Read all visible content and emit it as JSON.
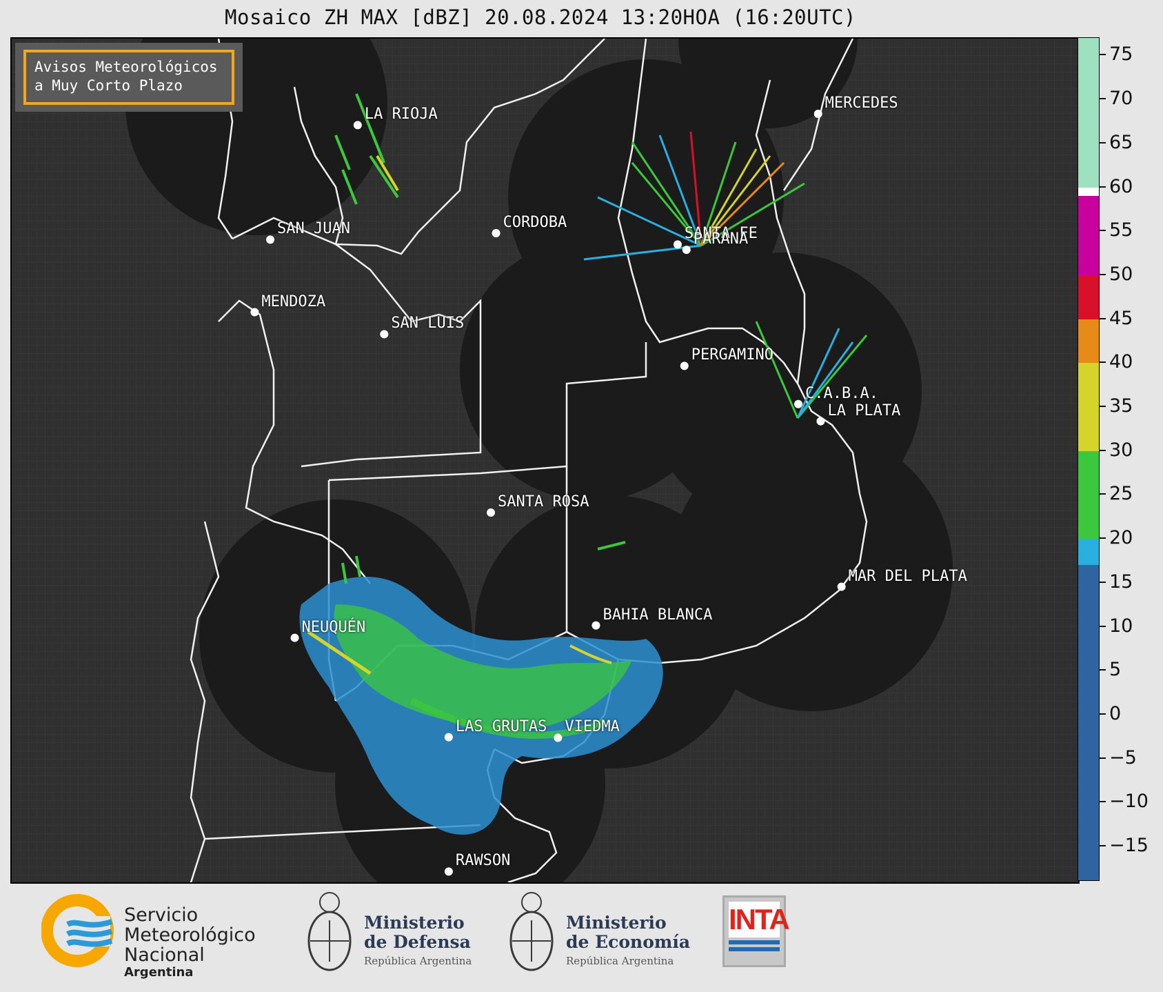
{
  "title": "Mosaico ZH MAX [dBZ] 20.08.2024 13:20HOA (16:20UTC)",
  "notice": {
    "line1": "Avisos Meteorológicos",
    "line2": "a Muy Corto Plazo"
  },
  "cities": [
    {
      "name": "LA RIOJA",
      "lon": -66.85,
      "lat": -29.41
    },
    {
      "name": "MERCEDES",
      "lon": -58.0,
      "lat": -29.2
    },
    {
      "name": "SAN JUAN",
      "lon": -68.53,
      "lat": -31.54
    },
    {
      "name": "CORDOBA",
      "lon": -64.19,
      "lat": -31.42
    },
    {
      "name": "SANTA FE",
      "lon": -60.7,
      "lat": -31.63
    },
    {
      "name": "PARANA",
      "lon": -60.53,
      "lat": -31.73
    },
    {
      "name": "MENDOZA",
      "lon": -68.83,
      "lat": -32.89
    },
    {
      "name": "SAN LUIS",
      "lon": -66.34,
      "lat": -33.3
    },
    {
      "name": "PERGAMINO",
      "lon": -60.57,
      "lat": -33.89
    },
    {
      "name": "C.A.B.A.",
      "lon": -58.38,
      "lat": -34.6
    },
    {
      "name": "LA PLATA",
      "lon": -57.95,
      "lat": -34.92
    },
    {
      "name": "SANTA ROSA",
      "lon": -64.29,
      "lat": -36.62
    },
    {
      "name": "MAR DEL PLATA",
      "lon": -57.55,
      "lat": -38.0
    },
    {
      "name": "BAHIA BLANCA",
      "lon": -62.27,
      "lat": -38.72
    },
    {
      "name": "NEUQUÉN",
      "lon": -68.06,
      "lat": -38.95
    },
    {
      "name": "LAS GRUTAS",
      "lon": -65.1,
      "lat": -40.8
    },
    {
      "name": "VIEDMA",
      "lon": -63.0,
      "lat": -40.81
    },
    {
      "name": "RAWSON",
      "lon": -65.1,
      "lat": -43.3
    }
  ],
  "colorbar": {
    "unit": "dBZ",
    "min": -19,
    "max": 77,
    "ticks": [
      "75",
      "70",
      "65",
      "60",
      "55",
      "50",
      "45",
      "40",
      "35",
      "30",
      "25",
      "20",
      "15",
      "10",
      "5",
      "0",
      "−5",
      "−10",
      "−15"
    ],
    "colors": [
      {
        "from": -19,
        "to": 17,
        "color": "#2e64a0"
      },
      {
        "from": 17,
        "to": 20,
        "color": "#2ab0e0"
      },
      {
        "from": 20,
        "to": 30,
        "color": "#3cc83c"
      },
      {
        "from": 30,
        "to": 40,
        "color": "#d4d42a"
      },
      {
        "from": 40,
        "to": 45,
        "color": "#e88a18"
      },
      {
        "from": 45,
        "to": 50,
        "color": "#d8102a"
      },
      {
        "from": 50,
        "to": 59,
        "color": "#c8009e"
      },
      {
        "from": 59,
        "to": 60,
        "color": "#ffffff"
      },
      {
        "from": 60,
        "to": 77,
        "color": "#9ee0c0"
      }
    ]
  },
  "logos": {
    "smn": {
      "line1": "Servicio",
      "line2": "Meteorológico",
      "line3": "Nacional",
      "country": "Argentina"
    },
    "defensa": {
      "line1": "Ministerio",
      "line2": "de Defensa",
      "sub": "República Argentina"
    },
    "economia": {
      "line1": "Ministerio",
      "line2": "de Economía",
      "sub": "República Argentina"
    },
    "inta": {
      "label": "INTA"
    }
  }
}
